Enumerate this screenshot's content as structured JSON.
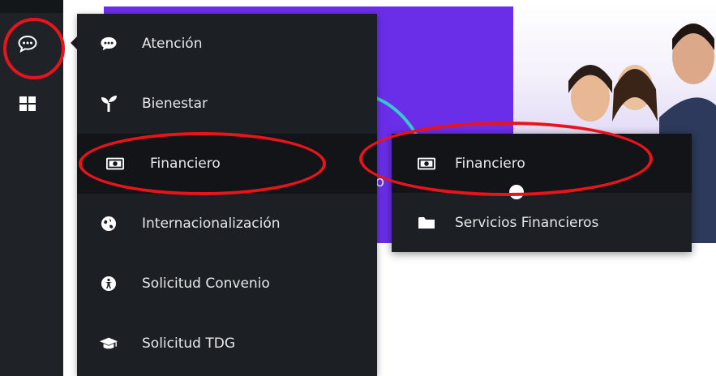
{
  "menu": {
    "items": [
      {
        "label": "Atención",
        "icon": "chat-bubble-icon"
      },
      {
        "label": "Bienestar",
        "icon": "sprout-icon"
      },
      {
        "label": "Financiero",
        "icon": "money-bill-icon",
        "active": true
      },
      {
        "label": "Internacionalización",
        "icon": "globe-icon"
      },
      {
        "label": "Solicitud Convenio",
        "icon": "accessibility-icon"
      },
      {
        "label": "Solicitud TDG",
        "icon": "graduation-cap-icon"
      }
    ]
  },
  "submenu": {
    "items": [
      {
        "label": "Financiero",
        "icon": "money-bill-icon",
        "active": true
      },
      {
        "label": "Servicios Financieros",
        "icon": "folder-icon"
      }
    ]
  },
  "colors": {
    "menu_bg": "#1c1f24",
    "menu_active_bg": "#121417",
    "rail_bg": "#1f2328",
    "banner_purple": "#6a2ee8",
    "annotation_red": "#e8141c"
  }
}
